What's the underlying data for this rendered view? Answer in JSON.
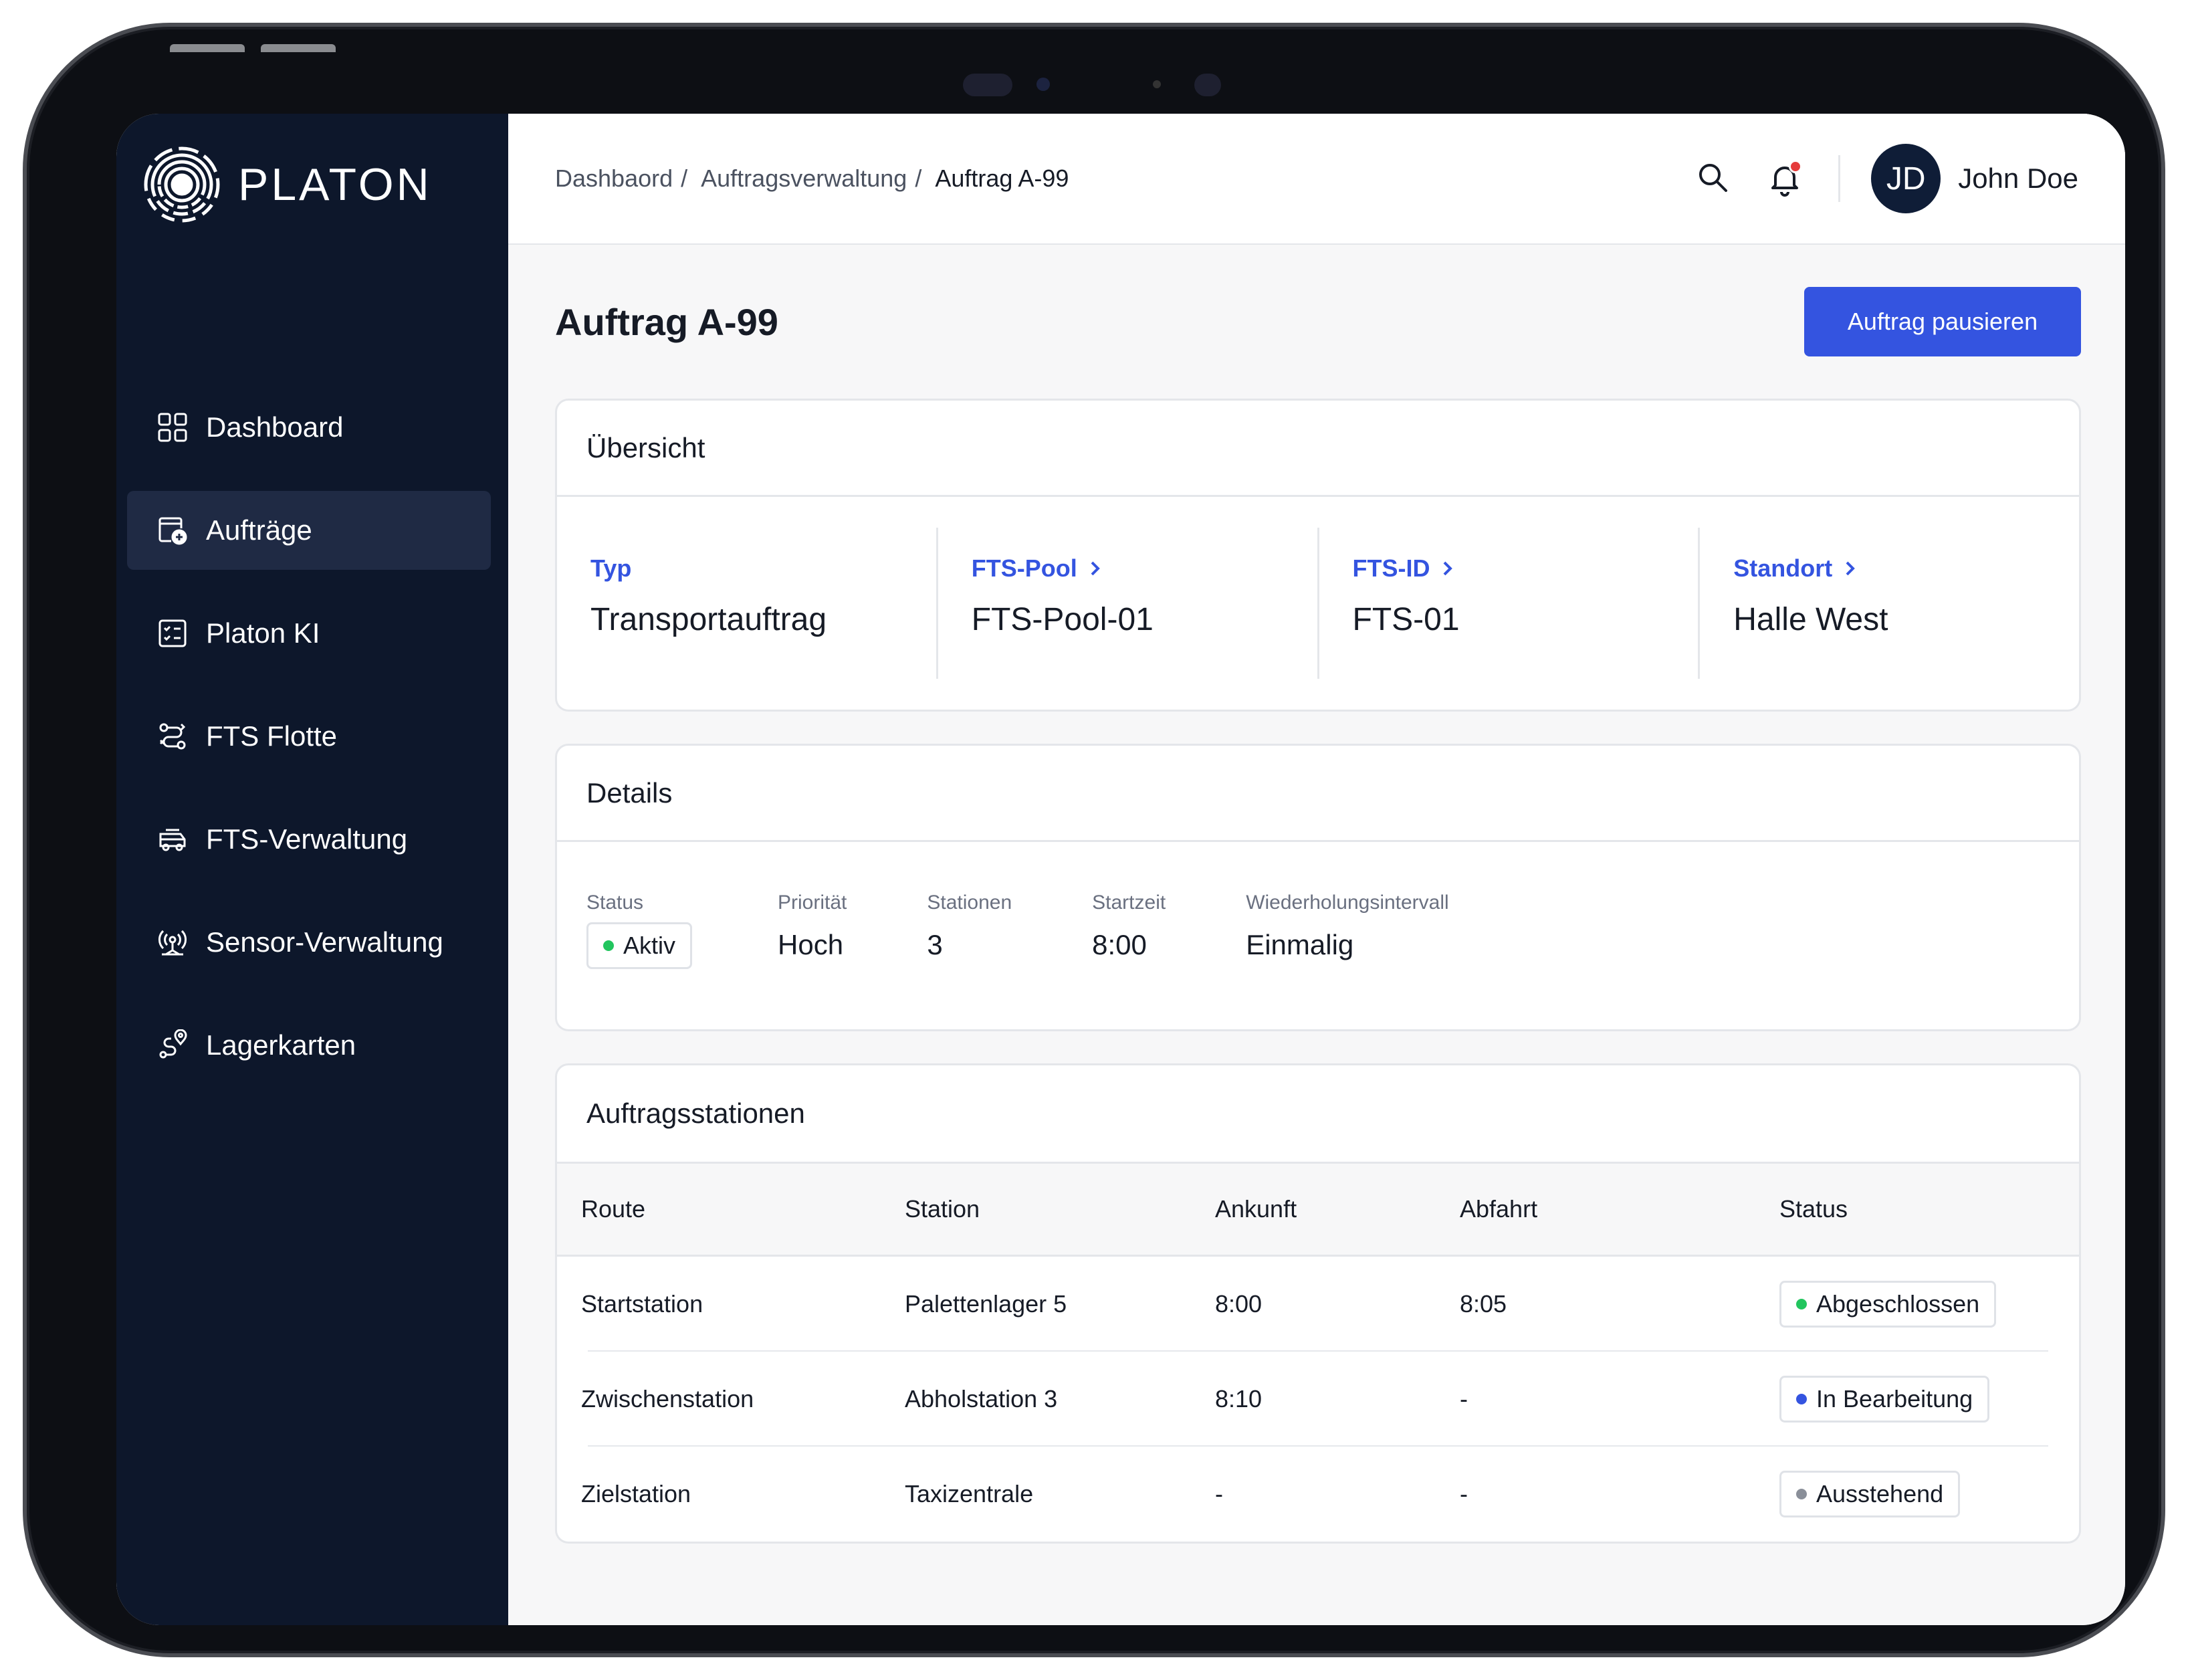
{
  "brand": {
    "name": "PLATON"
  },
  "sidebar": {
    "items": [
      {
        "label": "Dashboard",
        "icon": "grid-icon",
        "active": false
      },
      {
        "label": "Aufträge",
        "icon": "orders-icon",
        "active": true
      },
      {
        "label": "Platon KI",
        "icon": "checklist-icon",
        "active": false
      },
      {
        "label": "FTS Flotte",
        "icon": "route-icon",
        "active": false
      },
      {
        "label": "FTS-Verwaltung",
        "icon": "vehicle-icon",
        "active": false
      },
      {
        "label": "Sensor-Verwaltung",
        "icon": "sensor-icon",
        "active": false
      },
      {
        "label": "Lagerkarten",
        "icon": "map-pin-route-icon",
        "active": false
      }
    ]
  },
  "topbar": {
    "breadcrumb": [
      "Dashbaord",
      "Auftragsverwaltung",
      "Auftrag A-99"
    ],
    "user": {
      "initials": "JD",
      "name": "John Doe"
    }
  },
  "page": {
    "title": "Auftrag A-99",
    "primary_action": "Auftrag pausieren"
  },
  "overview": {
    "title": "Übersicht",
    "cells": [
      {
        "label": "Typ",
        "value": "Transportauftrag",
        "link": false
      },
      {
        "label": "FTS-Pool",
        "value": "FTS-Pool-01",
        "link": true
      },
      {
        "label": "FTS-ID",
        "value": "FTS-01",
        "link": true
      },
      {
        "label": "Standort",
        "value": "Halle West",
        "link": true
      }
    ]
  },
  "details": {
    "title": "Details",
    "status_label": "Status",
    "status_value": "Aktiv",
    "priority_label": "Priorität",
    "priority_value": "Hoch",
    "stations_label": "Stationen",
    "stations_value": "3",
    "start_label": "Startzeit",
    "start_value": "8:00",
    "interval_label": "Wiederholungsintervall",
    "interval_value": "Einmalig"
  },
  "stations": {
    "title": "Auftragsstationen",
    "columns": [
      "Route",
      "Station",
      "Ankunft",
      "Abfahrt",
      "Status"
    ],
    "rows": [
      {
        "route": "Startstation",
        "station": "Palettenlager 5",
        "arrival": "8:00",
        "departure": "8:05",
        "status": "Abgeschlossen",
        "status_color": "#22c55e"
      },
      {
        "route": "Zwischenstation",
        "station": "Abholstation 3",
        "arrival": "8:10",
        "departure": "-",
        "status": "In Bearbeitung",
        "status_color": "#3454e0"
      },
      {
        "route": "Zielstation",
        "station": "Taxizentrale",
        "arrival": "-",
        "departure": "-",
        "status": "Ausstehend",
        "status_color": "#8a8f99"
      }
    ]
  },
  "colors": {
    "sidebar_bg": "#0d172b",
    "accent": "#3454e0",
    "status_active": "#22c55e",
    "notification": "#e53b3b"
  }
}
